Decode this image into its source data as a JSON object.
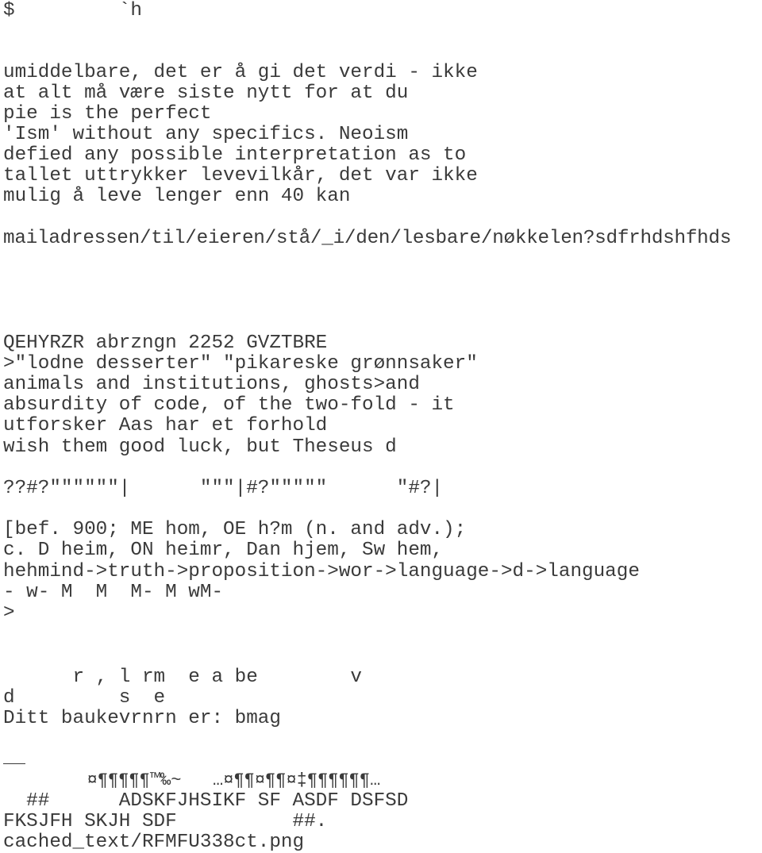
{
  "document": {
    "header_line": "$         `h",
    "block1": [
      "umiddelbare, det er å gi det verdi - ikke",
      "at alt må være siste nytt for at du",
      "pie is the perfect",
      "'Ism' without any specifics. Neoism",
      "defied any possible interpretation as to",
      "tallet uttrykker levevilkår, det var ikke",
      "mulig å leve lenger enn 40 kan"
    ],
    "path_line": "mailadressen/til/eieren/stå/_i/den/lesbare/nøkkelen?sdfrhdshfhds",
    "block2": [
      "QEHYRZR abrzngn 2252 GVZTBRE",
      ">\"lodne desserter\" \"pikareske grønnsaker\"",
      "animals and institutions, ghosts>and",
      "absurdity of code, of the two-fold - it",
      "utforsker Aas har et forhold",
      "wish them good luck, but Theseus d"
    ],
    "symbol_line": "??#?\"\"\"\"\"\"|      \"\"\"|#?\"\"\"\"\"      \"#?|",
    "block3": [
      "[bef. 900; ME hom, OE h?m (n. and adv.);",
      "c. D heim, ON heimr, Dan hjem, Sw hem,",
      "hehmind->truth->proposition->wor->language->d->language",
      "- w- M  M  M- M wM-",
      ">"
    ],
    "block4": [
      "      r , l rm  e a be        v",
      "d         s  e",
      "Ditt baukevrnrn er: bmag"
    ],
    "glyph_line": "        ¤¶¶¶¶¶™‰~   …¤¶¶¤¶¶¤‡¶¶¶¶¶¶…",
    "block5": [
      "  ##      ADSKFJHSIKF SF ASDF DSFSD",
      "FKSJFH SKJH SDF          ##.",
      "cached_text/RFMFU338ct.png"
    ]
  }
}
